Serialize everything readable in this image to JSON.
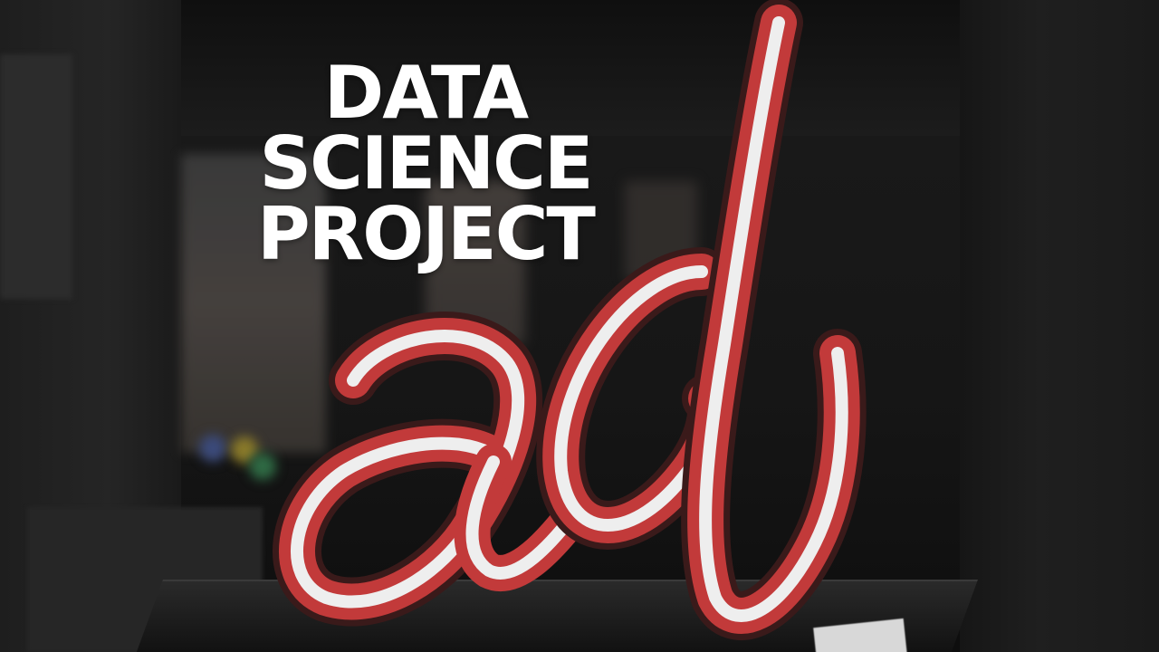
{
  "headline": {
    "line1": "DATA SCIENCE",
    "line2": "PROJECT"
  },
  "sign": {
    "letters": "ad",
    "colors": {
      "frame": "#c23a3a",
      "tube": "#eeeeee",
      "body": "#3a1a1a"
    }
  },
  "colors": {
    "text": "#ffffff",
    "background": "#161616"
  }
}
